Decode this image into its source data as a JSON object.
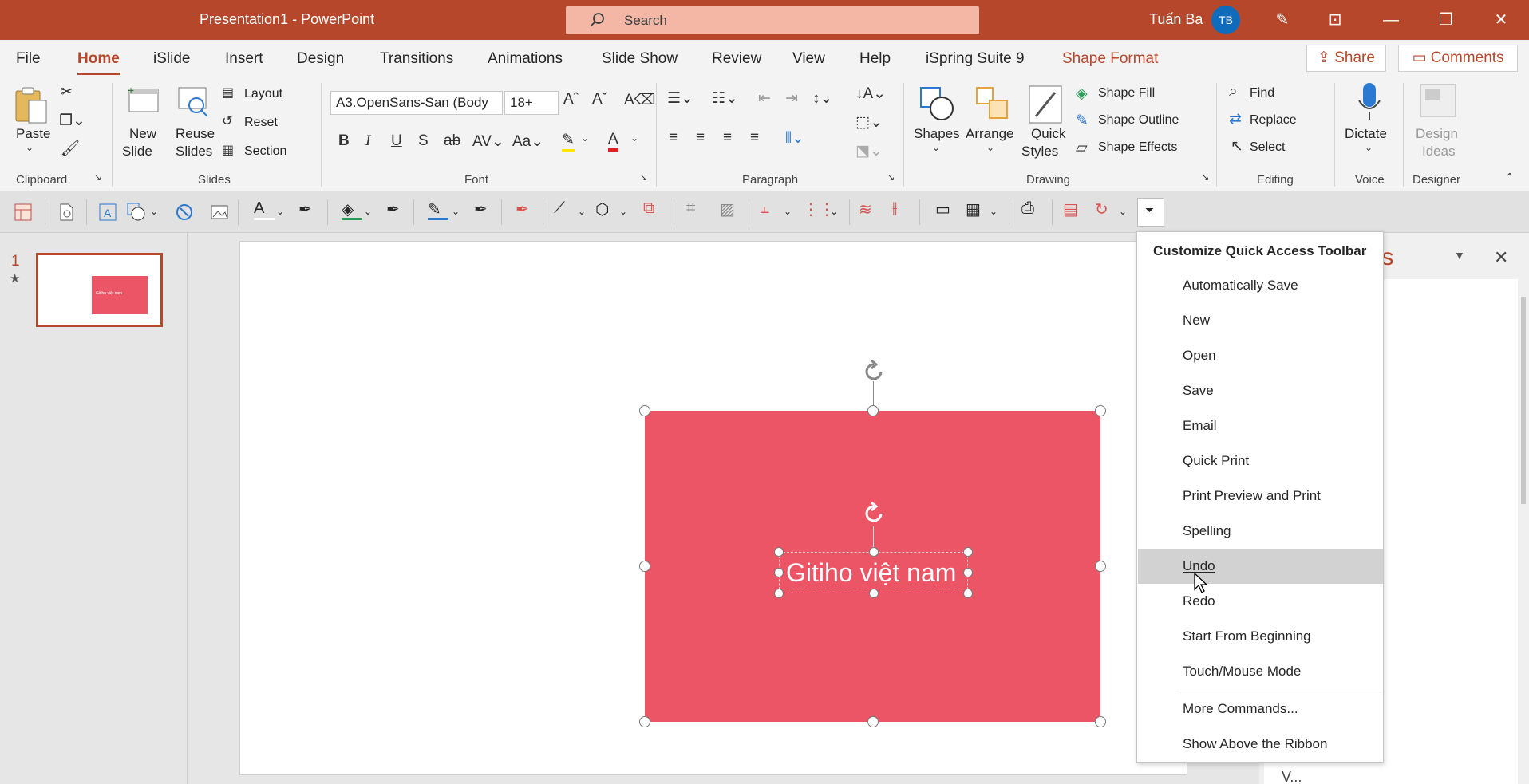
{
  "titlebar": {
    "title": "Presentation1  -  PowerPoint",
    "search_placeholder": "Search",
    "user_name": "Tuấn Ba",
    "user_initials": "TB"
  },
  "tabs": [
    "File",
    "Home",
    "iSlide",
    "Insert",
    "Design",
    "Transitions",
    "Animations",
    "Slide Show",
    "Review",
    "View",
    "Help",
    "iSpring Suite 9",
    "Shape Format"
  ],
  "active_tab": "Home",
  "share_label": "Share",
  "comments_label": "Comments",
  "ribbon": {
    "clipboard": {
      "paste": "Paste",
      "group": "Clipboard"
    },
    "slides": {
      "new_slide_1": "New",
      "new_slide_2": "Slide",
      "reuse_1": "Reuse",
      "reuse_2": "Slides",
      "layout": "Layout",
      "reset": "Reset",
      "section": "Section",
      "group": "Slides"
    },
    "font": {
      "font_name": "A3.OpenSans-San (Body",
      "font_size": "18+",
      "group": "Font"
    },
    "paragraph": {
      "group": "Paragraph"
    },
    "drawing": {
      "shapes": "Shapes",
      "arrange": "Arrange",
      "quick_1": "Quick",
      "quick_2": "Styles",
      "shape_fill": "Shape Fill",
      "shape_outline": "Shape Outline",
      "shape_effects": "Shape Effects",
      "group": "Drawing"
    },
    "editing": {
      "find": "Find",
      "replace": "Replace",
      "select": "Select",
      "group": "Editing"
    },
    "voice": {
      "dictate": "Dictate",
      "group": "Voice"
    },
    "designer": {
      "design_1": "Design",
      "design_2": "Ideas",
      "group": "Designer"
    }
  },
  "slide_pane": {
    "number": "1",
    "star": "★",
    "thumb_text": "Gitiho việt nam"
  },
  "slide": {
    "text": "Gitiho việt nam",
    "shape_color": "#ec5565"
  },
  "right_pane": {
    "title_fragment": "ols",
    "bottom_fragment": "V..."
  },
  "menu": {
    "heading": "Customize Quick Access Toolbar",
    "items": [
      "Automatically Save",
      "New",
      "Open",
      "Save",
      "Email",
      "Quick Print",
      "Print Preview and Print",
      "Spelling",
      "Undo",
      "Redo",
      "Start From Beginning",
      "Touch/Mouse Mode"
    ],
    "hovered": "Undo",
    "more_commands": "More Commands...",
    "show_above": "Show Above the Ribbon"
  },
  "colors": {
    "accent": "#b7472a",
    "shape": "#ec5565",
    "avatar": "#0f6cbd"
  }
}
